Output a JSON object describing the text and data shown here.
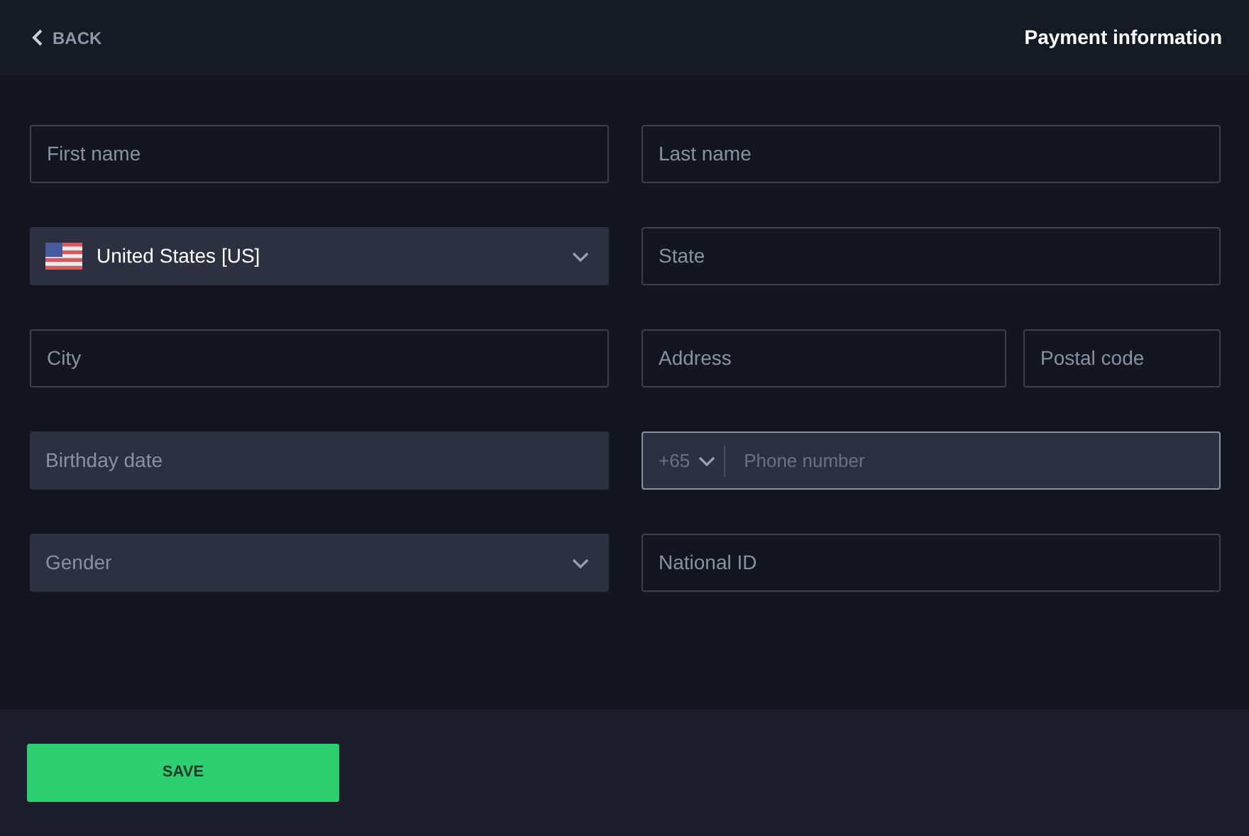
{
  "header": {
    "back": "BACK",
    "title": "Payment information"
  },
  "rows": [
    {
      "left": {
        "kind": "text",
        "placeholder": "First name"
      },
      "right": [
        {
          "kind": "text",
          "placeholder": "Last name"
        }
      ]
    },
    {
      "left": {
        "kind": "country",
        "value": "United States [US]"
      },
      "right": [
        {
          "kind": "text",
          "placeholder": "State"
        }
      ]
    },
    {
      "left": {
        "kind": "text",
        "placeholder": "City"
      },
      "right": [
        {
          "kind": "text",
          "placeholder": "Address"
        },
        {
          "kind": "text",
          "placeholder": "Postal code"
        }
      ]
    },
    {
      "left": {
        "kind": "date",
        "placeholder": "Birthday date"
      },
      "right": [
        {
          "kind": "phone",
          "code": "+65",
          "placeholder": "Phone number",
          "focused": true
        }
      ]
    },
    {
      "left": {
        "kind": "select",
        "placeholder": "Gender"
      },
      "right": [
        {
          "kind": "text",
          "placeholder": "National ID"
        }
      ]
    }
  ],
  "save": "SAVE"
}
